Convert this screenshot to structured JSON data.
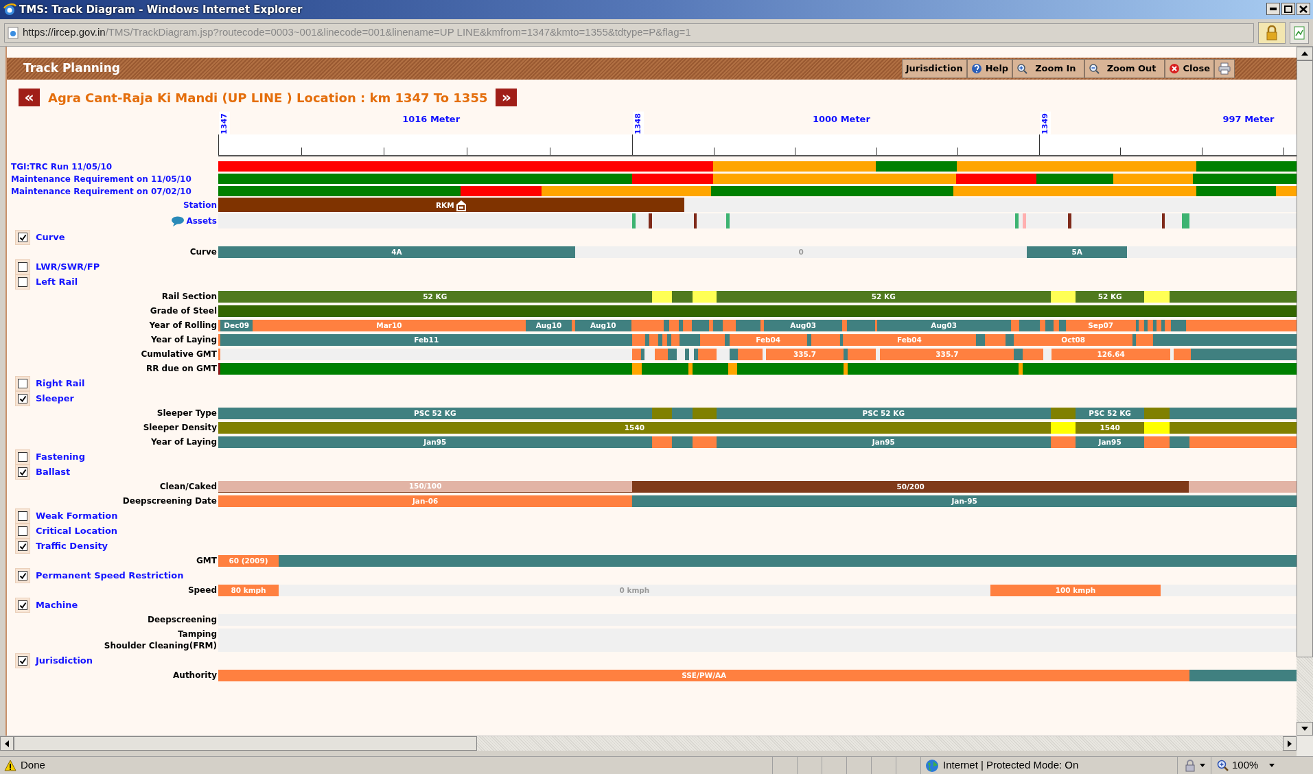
{
  "window": {
    "title": "TMS: Track Diagram - Windows Internet Explorer"
  },
  "address_bar": {
    "host": "https://ircep.gov.in",
    "path": "/TMS/TrackDiagram.jsp?routecode=0003~001&linecode=001&linename=UP LINE&kmfrom=1347&kmto=1355&tdtype=P&flag=1"
  },
  "panel": {
    "title": "Track Planning",
    "buttons": [
      {
        "kind": "text",
        "label": "Jurisdiction"
      },
      {
        "kind": "help",
        "label": "Help"
      },
      {
        "kind": "zoom_in",
        "label": "Zoom In"
      },
      {
        "kind": "zoom_out",
        "label": "Zoom Out"
      },
      {
        "kind": "close",
        "label": "Close"
      },
      {
        "kind": "print"
      }
    ]
  },
  "heading": {
    "prev": "«",
    "title": "Agra Cant-Raja Ki Mandi (UP LINE ) Location : km 1347 To 1355",
    "next": "»"
  },
  "ruler": {
    "spans": [
      {
        "marker": "1347",
        "label": "1016 Meter"
      },
      {
        "marker": "1348",
        "label": "1000 Meter"
      },
      {
        "marker": "1349",
        "label": "997 Meter"
      }
    ]
  },
  "rows": [
    {
      "kind": "summary",
      "label": "TGI:TRC Run 11/05/10",
      "segments": [
        {
          "color": "#ff0000"
        },
        {
          "color": "#ffa500"
        },
        {
          "color": "#008000"
        },
        {
          "color": "#ffa500"
        },
        {
          "color": "#008000"
        }
      ]
    },
    {
      "kind": "summary",
      "label": "Maintenance Requirement on 11/05/10",
      "segments": [
        {
          "color": "#008000"
        },
        {
          "color": "#ff0000"
        },
        {
          "color": "#ffa500"
        },
        {
          "color": "#ff0000"
        },
        {
          "color": "#008000"
        },
        {
          "color": "#ffa500"
        },
        {
          "color": "#008000"
        }
      ]
    },
    {
      "kind": "summary",
      "label": "Maintenance Requirement on 07/02/10",
      "segments": [
        {
          "color": "#008000"
        },
        {
          "color": "#ff0000"
        },
        {
          "color": "#ffa500"
        },
        {
          "color": "#008000"
        },
        {
          "color": "#ffa500"
        },
        {
          "color": "#008000"
        },
        {
          "color": "#ffa500"
        }
      ]
    },
    {
      "kind": "station",
      "label": "Station",
      "segments": [
        {
          "color": "#7f3300",
          "text": "RKM"
        },
        {
          "color": "#f0f0f0"
        }
      ]
    },
    {
      "kind": "assets",
      "label": "Assets",
      "segments": [
        {
          "color": "#f0f0f0"
        },
        {
          "color": "#3cb371"
        },
        {
          "color": "#f0f0f0"
        },
        {
          "color": "#7f2a1a"
        },
        {
          "color": "#f0f0f0"
        },
        {
          "color": "#7f2a1a"
        },
        {
          "color": "#f0f0f0"
        },
        {
          "color": "#3cb371"
        },
        {
          "color": "#f0f0f0"
        },
        {
          "color": "#3cb371"
        },
        {
          "color": "#f0f0f0"
        },
        {
          "color": "#ffb0b0"
        },
        {
          "color": "#f0f0f0"
        },
        {
          "color": "#7f2a1a"
        },
        {
          "color": "#f0f0f0"
        },
        {
          "color": "#7f2a1a"
        },
        {
          "color": "#f0f0f0"
        },
        {
          "color": "#3cb371"
        },
        {
          "color": "#f0f0f0"
        }
      ]
    },
    {
      "kind": "section",
      "label": "Curve",
      "checked": true
    },
    {
      "kind": "bar",
      "labels": [
        "Curve"
      ],
      "segments": [
        {
          "color": "#408080",
          "text": "4A"
        },
        {
          "color": "#f0f0f0",
          "text": "0"
        },
        {
          "color": "#408080",
          "text": "5A"
        },
        {
          "color": "#f0f0f0"
        }
      ]
    },
    {
      "kind": "section",
      "label": "LWR/SWR/FP",
      "checked": false
    },
    {
      "kind": "section",
      "label": "Left Rail",
      "checked": false
    },
    {
      "kind": "bar",
      "labels": [
        "Rail Section"
      ],
      "segments": [
        {
          "color": "#4f7a1e",
          "text": "52 KG"
        },
        {
          "color": "#ffff55"
        },
        {
          "color": "#4f7a1e"
        },
        {
          "color": "#ffff55"
        },
        {
          "color": "#4f7a1e",
          "text": "52 KG"
        },
        {
          "color": "#ffff55"
        },
        {
          "color": "#4f7a1e",
          "text": "52 KG"
        },
        {
          "color": "#ffff55"
        },
        {
          "color": "#4f7a1e"
        }
      ]
    },
    {
      "kind": "bar",
      "labels": [
        "Grade of Steel"
      ],
      "segments": [
        {
          "color": "#336600"
        }
      ]
    },
    {
      "kind": "bar",
      "labels": [
        "Year of Rolling"
      ],
      "segments": [
        {
          "color": "#ff8040"
        },
        {
          "color": "#408080",
          "text": "Dec09"
        },
        {
          "color": "#ff8040",
          "text": "Mar10"
        },
        {
          "color": "#408080",
          "text": "Aug10"
        },
        {
          "color": "#ff8040"
        },
        {
          "color": "#408080",
          "text": "Aug10"
        },
        {
          "color": "#ff8040"
        },
        {
          "color": "#408080"
        },
        {
          "color": "#ff8040"
        },
        {
          "color": "#408080"
        },
        {
          "color": "#ff8040"
        },
        {
          "color": "#408080"
        },
        {
          "color": "#ff8040"
        },
        {
          "color": "#408080"
        },
        {
          "color": "#ff8040"
        },
        {
          "color": "#408080"
        },
        {
          "color": "#ff8040"
        },
        {
          "color": "#408080",
          "text": "Aug03"
        },
        {
          "color": "#ff8040"
        },
        {
          "color": "#408080"
        },
        {
          "color": "#ff8040"
        },
        {
          "color": "#408080",
          "text": "Aug03"
        },
        {
          "color": "#ff8040"
        },
        {
          "color": "#408080"
        },
        {
          "color": "#ff8040"
        },
        {
          "color": "#408080"
        },
        {
          "color": "#ff8040"
        },
        {
          "color": "#408080"
        },
        {
          "color": "#ff8040",
          "text": "Sep07"
        },
        {
          "color": "#408080"
        },
        {
          "color": "#ff8040"
        },
        {
          "color": "#408080"
        },
        {
          "color": "#ff8040"
        },
        {
          "color": "#408080"
        },
        {
          "color": "#ff8040"
        },
        {
          "color": "#408080"
        },
        {
          "color": "#ff8040"
        },
        {
          "color": "#408080"
        },
        {
          "color": "#ff8040"
        }
      ]
    },
    {
      "kind": "bar",
      "labels": [
        "Year of Laying"
      ],
      "segments": [
        {
          "color": "#ff8040"
        },
        {
          "color": "#408080",
          "text": "Feb11"
        },
        {
          "color": "#ff8040"
        },
        {
          "color": "#408080"
        },
        {
          "color": "#ff8040"
        },
        {
          "color": "#408080"
        },
        {
          "color": "#ff8040"
        },
        {
          "color": "#408080"
        },
        {
          "color": "#ff8040"
        },
        {
          "color": "#408080"
        },
        {
          "color": "#ff8040"
        },
        {
          "color": "#408080"
        },
        {
          "color": "#ff8040",
          "text": "Feb04"
        },
        {
          "color": "#408080"
        },
        {
          "color": "#ff8040"
        },
        {
          "color": "#408080"
        },
        {
          "color": "#ff8040",
          "text": "Feb04"
        },
        {
          "color": "#408080"
        },
        {
          "color": "#ff8040"
        },
        {
          "color": "#408080"
        },
        {
          "color": "#ff8040",
          "text": "Oct08"
        },
        {
          "color": "#408080"
        },
        {
          "color": "#ff8040"
        },
        {
          "color": "#408080"
        }
      ]
    },
    {
      "kind": "bar",
      "labels": [
        "Cumulative GMT"
      ],
      "segments": [
        {
          "color": "#ff8040"
        },
        {
          "color": "#f0f0f0"
        },
        {
          "color": "#ff8040"
        },
        {
          "color": "#408080"
        },
        {
          "color": "#f0f0f0"
        },
        {
          "color": "#ff8040"
        },
        {
          "color": "#408080"
        },
        {
          "color": "#f0f0f0"
        },
        {
          "color": "#408080"
        },
        {
          "color": "#f0f0f0"
        },
        {
          "color": "#408080"
        },
        {
          "color": "#ff8040"
        },
        {
          "color": "#f0f0f0"
        },
        {
          "color": "#408080"
        },
        {
          "color": "#ff8040"
        },
        {
          "color": "#f0f0f0"
        },
        {
          "color": "#ff8040",
          "text": "335.7"
        },
        {
          "color": "#408080"
        },
        {
          "color": "#ff8040"
        },
        {
          "color": "#f0f0f0"
        },
        {
          "color": "#ff8040",
          "text": "335.7"
        },
        {
          "color": "#408080"
        },
        {
          "color": "#ff8040"
        },
        {
          "color": "#f0f0f0"
        },
        {
          "color": "#ff8040",
          "text": "126.64"
        },
        {
          "color": "#f0f0f0"
        },
        {
          "color": "#ff8040"
        },
        {
          "color": "#408080"
        }
      ]
    },
    {
      "kind": "bar",
      "labels": [
        "RR due on GMT"
      ],
      "segments": [
        {
          "color": "#8b1a1a"
        },
        {
          "color": "#008000"
        },
        {
          "color": "#ffa500"
        },
        {
          "color": "#008000"
        },
        {
          "color": "#ffa500"
        },
        {
          "color": "#008000"
        },
        {
          "color": "#ffa500"
        },
        {
          "color": "#008000"
        },
        {
          "color": "#ffa500"
        },
        {
          "color": "#008000"
        },
        {
          "color": "#ffa500"
        },
        {
          "color": "#008000"
        }
      ]
    },
    {
      "kind": "section",
      "label": "Right Rail",
      "checked": false
    },
    {
      "kind": "section",
      "label": "Sleeper",
      "checked": true
    },
    {
      "kind": "bar",
      "labels": [
        "Sleeper Type"
      ],
      "segments": [
        {
          "color": "#408080",
          "text": "PSC 52 KG"
        },
        {
          "color": "#808000"
        },
        {
          "color": "#408080"
        },
        {
          "color": "#808000"
        },
        {
          "color": "#408080",
          "text": "PSC 52 KG"
        },
        {
          "color": "#808000"
        },
        {
          "color": "#408080",
          "text": "PSC 52 KG"
        },
        {
          "color": "#808000"
        },
        {
          "color": "#408080"
        }
      ]
    },
    {
      "kind": "bar",
      "labels": [
        "Sleeper Density"
      ],
      "segments": [
        {
          "color": "#808000",
          "text": "1540"
        },
        {
          "color": "#ffff00"
        },
        {
          "color": "#808000",
          "text": "1540"
        },
        {
          "color": "#ffff00"
        },
        {
          "color": "#808000"
        }
      ]
    },
    {
      "kind": "bar",
      "labels": [
        "Year of Laying"
      ],
      "segments": [
        {
          "color": "#408080",
          "text": "Jan95"
        },
        {
          "color": "#ff8040"
        },
        {
          "color": "#408080"
        },
        {
          "color": "#ff8040"
        },
        {
          "color": "#408080",
          "text": "Jan95"
        },
        {
          "color": "#ff8040"
        },
        {
          "color": "#408080",
          "text": "Jan95"
        },
        {
          "color": "#ff8040"
        },
        {
          "color": "#408080"
        },
        {
          "color": "#ff8040"
        }
      ]
    },
    {
      "kind": "section",
      "label": "Fastening",
      "checked": false
    },
    {
      "kind": "section",
      "label": "Ballast",
      "checked": true
    },
    {
      "kind": "bar",
      "labels": [
        "Clean/Caked"
      ],
      "segments": [
        {
          "color": "#e2b4a5",
          "stripe": {
            "color": "#7f3a1a"
          },
          "text": "150/100"
        },
        {
          "color": "#7f3a1a",
          "text": "50/200"
        },
        {
          "color": "#e2b4a5"
        }
      ]
    },
    {
      "kind": "bar",
      "labels": [
        "Deepscreening Date"
      ],
      "segments": [
        {
          "color": "#ff8040",
          "text": "Jan-06"
        },
        {
          "color": "#408080",
          "text": "Jan-95"
        }
      ]
    },
    {
      "kind": "section",
      "label": "Weak Formation",
      "checked": false
    },
    {
      "kind": "section",
      "label": "Critical Location",
      "checked": false
    },
    {
      "kind": "section",
      "label": "Traffic Density",
      "checked": true
    },
    {
      "kind": "bar",
      "labels": [
        "GMT"
      ],
      "segments": [
        {
          "color": "#ff8040",
          "text": "60 (2009)"
        },
        {
          "color": "#408080"
        }
      ]
    },
    {
      "kind": "section",
      "label": "Permanent Speed Restriction",
      "checked": true
    },
    {
      "kind": "bar",
      "labels": [
        "Speed"
      ],
      "segments": [
        {
          "color": "#ff8040",
          "text": "80 kmph"
        },
        {
          "color": "#f0f0f0",
          "text": "0 kmph"
        },
        {
          "color": "#ff8040",
          "text": "100 kmph"
        },
        {
          "color": "#f0f0f0"
        }
      ]
    },
    {
      "kind": "section",
      "label": "Machine",
      "checked": true
    },
    {
      "kind": "bar",
      "labels": [
        "Deepscreening"
      ],
      "segments": [
        {
          "color": "#f0f0f0"
        }
      ]
    },
    {
      "kind": "bar",
      "labels": [
        "Tamping",
        "Shoulder Cleaning(FRM)"
      ],
      "segments": [
        {
          "color": "#f0f0f0"
        }
      ]
    },
    {
      "kind": "section",
      "label": "Jurisdiction",
      "checked": true
    },
    {
      "kind": "bar",
      "labels": [
        "Authority"
      ],
      "segments": [
        {
          "color": "#ff8040",
          "text": "SSE/PW/AA"
        },
        {
          "color": "#408080"
        }
      ]
    }
  ],
  "status_bar": {
    "text": "Done",
    "zone": "Internet | Protected Mode: On",
    "zoom": "100%"
  }
}
